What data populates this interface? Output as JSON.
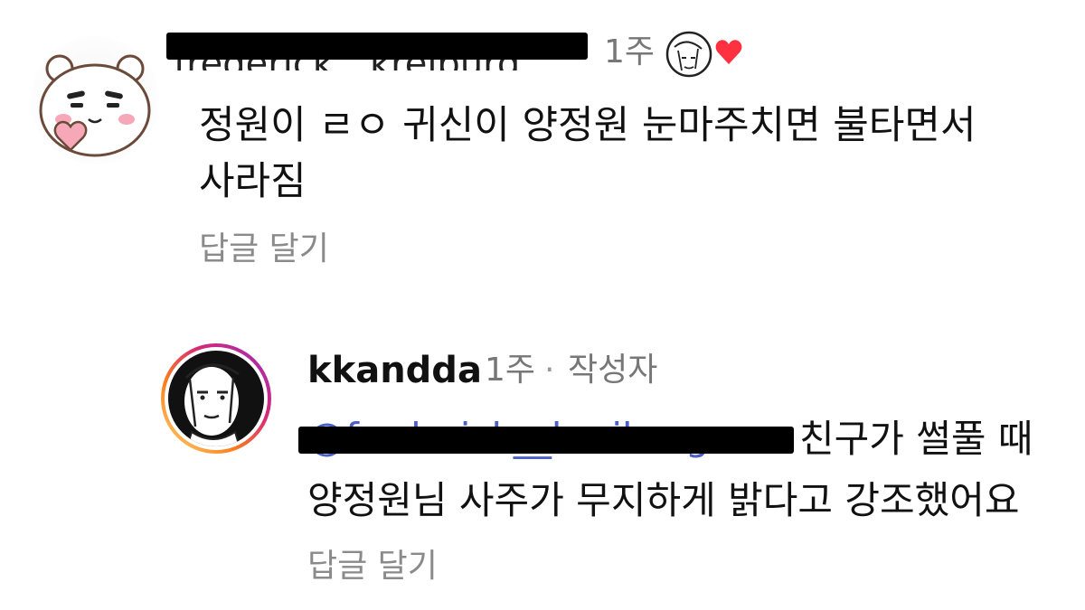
{
  "comment1": {
    "username": "frederick__kreiburg",
    "time": "1주",
    "text": "정원이 ㄹㅇ 귀신이 양정원 눈마주치면 불타면서\n사라짐",
    "reply_label": "답글 달기"
  },
  "comment2": {
    "username": "kkandda",
    "time": "1주",
    "separator": "·",
    "author_badge": "작성자",
    "mention": "@frederick__kreiburg",
    "text_line1": "친구가 썰풀 때",
    "text_line2": "양정원님 사주가 무지하게 밝다고 강조했어요",
    "reply_label": "답글 달기"
  },
  "colors": {
    "like_heart": "#ff3040",
    "mention": "#4a5fc8",
    "secondary_text": "#8a8a8a",
    "story_ring_start": "#feda75",
    "story_ring_mid": "#d62976",
    "story_ring_end": "#962fbf"
  },
  "icons": {
    "avatar1": "bear-holding-heart-icon",
    "author_like": "author-avatar-with-heart-icon",
    "avatar2": "sketch-face-avatar-icon"
  }
}
